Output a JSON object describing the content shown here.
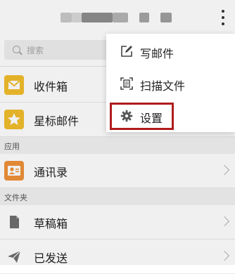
{
  "header": {
    "title_blurred": true,
    "more_icon": "more-vertical-icon"
  },
  "search": {
    "placeholder": "搜索",
    "icon": "search-icon"
  },
  "list": {
    "inbox": {
      "label": "收件箱",
      "icon": "envelope-icon",
      "color": "#f2be2c"
    },
    "starred": {
      "label": "星标邮件",
      "icon": "star-icon",
      "color": "#f2be2c"
    }
  },
  "sections": {
    "apps": "应用",
    "folders": "文件夹"
  },
  "apps": {
    "contacts": {
      "label": "通讯录",
      "icon": "contact-card-icon",
      "color": "#f0913a"
    }
  },
  "folders": {
    "drafts": {
      "label": "草稿箱",
      "icon": "document-icon"
    },
    "sent": {
      "label": "已发送",
      "icon": "paper-plane-icon"
    }
  },
  "menu": {
    "items": [
      {
        "label": "写邮件",
        "icon": "compose-icon"
      },
      {
        "label": "扫描文件",
        "icon": "scan-icon"
      },
      {
        "label": "设置",
        "icon": "gear-icon"
      }
    ],
    "highlight_color": "#b01c1c"
  }
}
